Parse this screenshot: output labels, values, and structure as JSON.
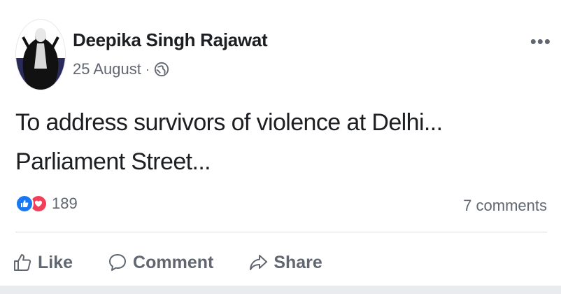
{
  "post": {
    "author": "Deepika Singh Rajawat",
    "date": "25 August",
    "separator": "·",
    "privacy_icon": "globe-icon",
    "more_label": "•••",
    "text": "To address survivors of violence at Delhi...\nParliament Street..."
  },
  "stats": {
    "reaction_icons": [
      "like-icon",
      "love-icon"
    ],
    "reactions_count": "189",
    "comments": "7 comments"
  },
  "actions": {
    "like": "Like",
    "comment": "Comment",
    "share": "Share"
  },
  "colors": {
    "like_blue": "#1877f2",
    "love_red": "#f33e58",
    "secondary_text": "#606770",
    "primary_text": "#1c1e21"
  }
}
